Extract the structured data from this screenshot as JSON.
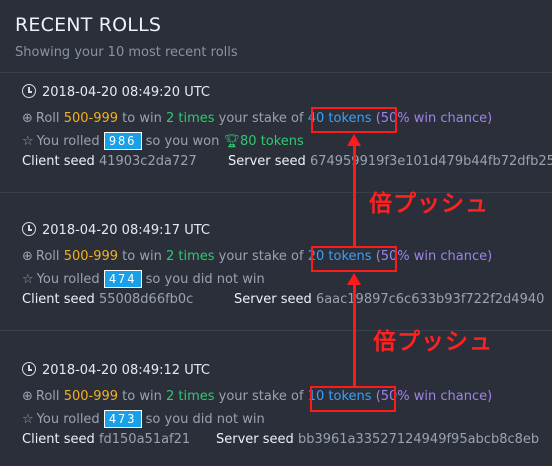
{
  "header": {
    "title": "RECENT ROLLS",
    "subtitle": "Showing your 10 most recent rolls"
  },
  "labels": {
    "roll": "Roll",
    "to_win": "to win",
    "your_stake_of": "your stake of",
    "you_rolled": "You rolled",
    "so_you_won": "so you won",
    "so_you_did_not_win": "so you did not win",
    "client_seed": "Client seed",
    "server_seed": "Server seed"
  },
  "rolls": [
    {
      "timestamp": "2018-04-20 08:49:20 UTC",
      "range": "500-999",
      "multiplier": "2 times",
      "stake": "40 tokens",
      "chance": "(50% win chance)",
      "rolled": "986",
      "outcome_text": "so you won",
      "won_amount": "80 tokens",
      "client_seed": "41903c2da727",
      "server_seed": "674959919f3e101d479b44fb72dfb25"
    },
    {
      "timestamp": "2018-04-20 08:49:17 UTC",
      "range": "500-999",
      "multiplier": "2 times",
      "stake": "20 tokens",
      "chance": "(50% win chance)",
      "rolled": "474",
      "outcome_text": "so you did not win",
      "won_amount": "",
      "client_seed": "55008d66fb0c",
      "server_seed": "6aac19897c6c633b93f722f2d4940"
    },
    {
      "timestamp": "2018-04-20 08:49:12 UTC",
      "range": "500-999",
      "multiplier": "2 times",
      "stake": "10 tokens",
      "chance": "(50% win chance)",
      "rolled": "473",
      "outcome_text": "so you did not win",
      "won_amount": "",
      "client_seed": "fd150a51af21",
      "server_seed": "bb3961a33527124949f95abcb8c8eb"
    }
  ],
  "annotations": {
    "text": "倍プッシュ"
  },
  "colors": {
    "background": "#2b2f3a",
    "range": "#f2b01e",
    "multiplier": "#2fc96f",
    "stake": "#3aa0f5",
    "chance": "#9d84e8",
    "rolled_badge": "#18a0e8",
    "annotation": "#ff1a1a"
  },
  "icons": {
    "timestamp": "clock-icon",
    "roll": "crosshair-icon",
    "rolled": "star-icon",
    "won": "trophy-icon"
  }
}
